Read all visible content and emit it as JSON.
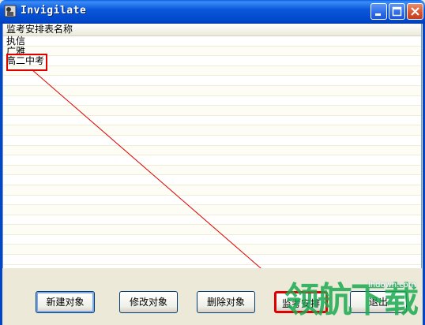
{
  "window": {
    "title": "Invigilate"
  },
  "listview": {
    "column_header": "监考安排表名称",
    "rows": [
      "执信",
      "广雅",
      "高二中考",
      "",
      "",
      "",
      "",
      "",
      "",
      "",
      "",
      "",
      "",
      "",
      "",
      "",
      "",
      "",
      "",
      "",
      "",
      "",
      ""
    ]
  },
  "buttons": {
    "new": "新建对象",
    "edit": "修改对象",
    "delete": "删除对象",
    "arrange": "监考安排",
    "exit": "退出"
  },
  "watermark": {
    "text": "领航下载",
    "url": "lhdown.com"
  },
  "colors": {
    "annotation_red": "#E00000",
    "titlebar_blue": "#0A58DC",
    "watermark_green": "#1AAA50"
  },
  "icons": {
    "app": "app-icon",
    "minimize": "minimize-icon",
    "maximize": "maximize-icon",
    "close": "close-icon"
  }
}
